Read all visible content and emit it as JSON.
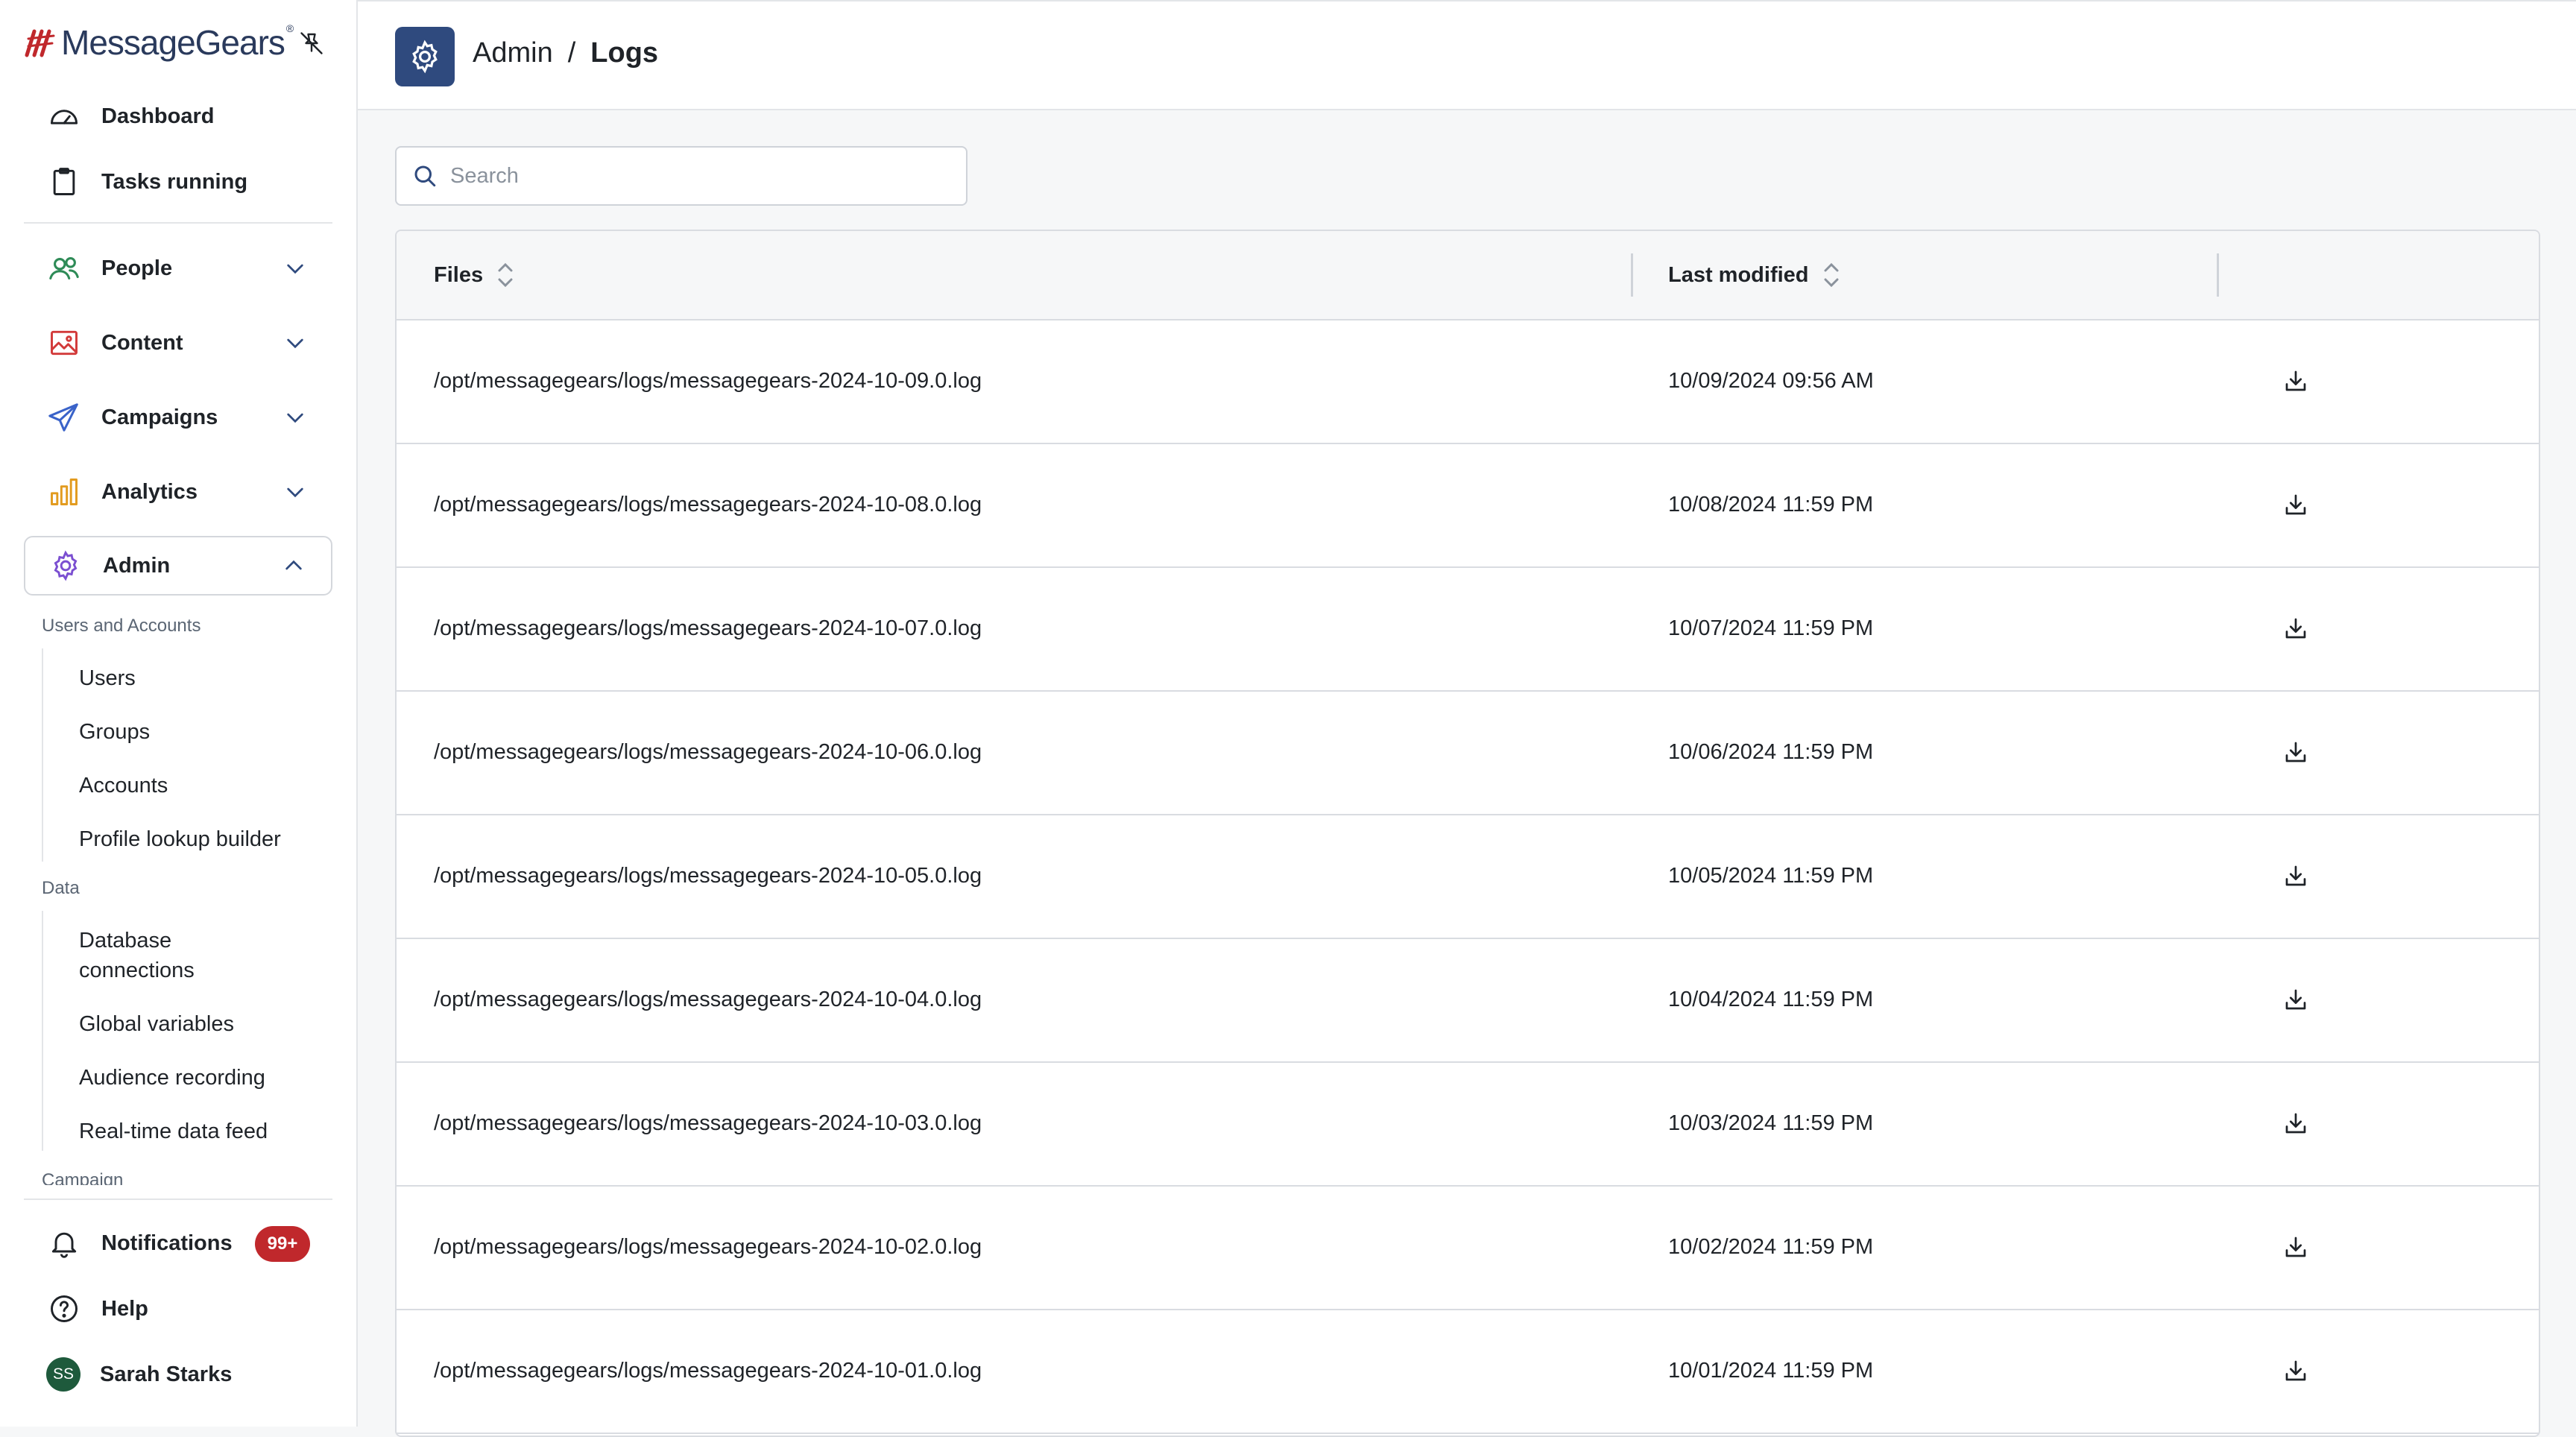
{
  "brand": {
    "name": "MessageGears",
    "trademark": "®"
  },
  "nav": {
    "dashboard": "Dashboard",
    "tasks": "Tasks running",
    "people": "People",
    "content": "Content",
    "campaigns": "Campaigns",
    "analytics": "Analytics",
    "admin": "Admin"
  },
  "admin_sub": {
    "users_accounts_label": "Users and Accounts",
    "users": "Users",
    "groups": "Groups",
    "accounts": "Accounts",
    "profile_lookup": "Profile lookup builder",
    "data_label": "Data",
    "database_connections_1": "Database",
    "database_connections_2": "connections",
    "global_variables": "Global variables",
    "audience_recording": "Audience recording",
    "realtime_feed": "Real-time data feed",
    "campaign_label": "Campaign"
  },
  "footer": {
    "notifications": "Notifications",
    "notifications_badge": "99+",
    "help": "Help",
    "user_initials": "SS",
    "user_name": "Sarah Starks"
  },
  "header": {
    "crumb_parent": "Admin",
    "crumb_sep": "/",
    "crumb_current": "Logs"
  },
  "search": {
    "placeholder": "Search"
  },
  "table": {
    "col_files": "Files",
    "col_modified": "Last modified",
    "rows": [
      {
        "file": "/opt/messagegears/logs/messagegears-2024-10-09.0.log",
        "modified": "10/09/2024 09:56 AM"
      },
      {
        "file": "/opt/messagegears/logs/messagegears-2024-10-08.0.log",
        "modified": "10/08/2024 11:59 PM"
      },
      {
        "file": "/opt/messagegears/logs/messagegears-2024-10-07.0.log",
        "modified": "10/07/2024 11:59 PM"
      },
      {
        "file": "/opt/messagegears/logs/messagegears-2024-10-06.0.log",
        "modified": "10/06/2024 11:59 PM"
      },
      {
        "file": "/opt/messagegears/logs/messagegears-2024-10-05.0.log",
        "modified": "10/05/2024 11:59 PM"
      },
      {
        "file": "/opt/messagegears/logs/messagegears-2024-10-04.0.log",
        "modified": "10/04/2024 11:59 PM"
      },
      {
        "file": "/opt/messagegears/logs/messagegears-2024-10-03.0.log",
        "modified": "10/03/2024 11:59 PM"
      },
      {
        "file": "/opt/messagegears/logs/messagegears-2024-10-02.0.log",
        "modified": "10/02/2024 11:59 PM"
      },
      {
        "file": "/opt/messagegears/logs/messagegears-2024-10-01.0.log",
        "modified": "10/01/2024 11:59 PM"
      }
    ]
  },
  "colors": {
    "brand_red": "#c0282c",
    "header_icon_bg": "#2f4a7e",
    "people_icon": "#2e8b57",
    "content_icon": "#d23a3a",
    "campaigns_icon": "#3a63c9",
    "analytics_icon": "#e29b1f",
    "admin_icon": "#7b4fd1",
    "avatar_bg": "#1e5a3c"
  },
  "icons": {
    "dashboard": "speedometer-icon",
    "tasks": "clipboard-icon",
    "people": "people-icon",
    "content": "image-icon",
    "campaigns": "paper-plane-icon",
    "analytics": "bar-chart-icon",
    "admin": "gear-icon",
    "notifications": "bell-icon",
    "help": "question-circle-icon",
    "download": "download-icon"
  }
}
